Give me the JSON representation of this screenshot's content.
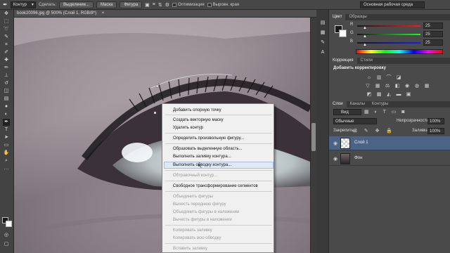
{
  "options_bar": {
    "mode": "Контур",
    "create_label": "Сделать:",
    "selection_btn": "Выделение...",
    "mask_btn": "Маска",
    "shape_btn": "Фигура",
    "optimization": "Оптимизация",
    "align_edges": "Выровн. края",
    "workspace": "Основная рабочая среда"
  },
  "document_tab": {
    "title": "book20096.jpg @ 500% (Слой 1, RGB/8*)",
    "close": "×"
  },
  "context_menu": {
    "items": [
      {
        "label": "Добавить опорную точку",
        "enabled": true
      },
      {
        "label": "Создать векторную маску",
        "enabled": true
      },
      {
        "label": "Удалить контур",
        "enabled": true
      },
      {
        "label": "Определить произвольную фигуру...",
        "enabled": true
      },
      {
        "label": "Образовать выделенную область...",
        "enabled": true
      },
      {
        "label": "Выполнить заливку контура...",
        "enabled": true
      },
      {
        "label": "Выполнить обводку контура...",
        "enabled": true
      },
      {
        "label": "Обтравочный контур...",
        "enabled": false
      },
      {
        "label": "Свободное трансформирование сегментов",
        "enabled": true
      },
      {
        "label": "Объединить фигуры",
        "enabled": false
      },
      {
        "label": "Вычесть переднюю фигуру",
        "enabled": false
      },
      {
        "label": "Объединить фигуры в наложении",
        "enabled": false
      },
      {
        "label": "Вычесть фигуры в наложении",
        "enabled": false
      },
      {
        "label": "Копировать заливку",
        "enabled": false
      },
      {
        "label": "Копировать всю обводку",
        "enabled": false
      },
      {
        "label": "Вставить заливку",
        "enabled": false
      }
    ]
  },
  "color_panel": {
    "tabs": [
      "Цвет",
      "Образцы"
    ],
    "channels": [
      {
        "label": "R",
        "value": "25",
        "color": "#d03030"
      },
      {
        "label": "G",
        "value": "25",
        "color": "#30a030"
      },
      {
        "label": "B",
        "value": "25",
        "color": "#3050d0"
      }
    ]
  },
  "adjustments_panel": {
    "tabs": [
      "Коррекция",
      "Стили"
    ],
    "title": "Добавить корректировку"
  },
  "layers_panel": {
    "tabs": [
      "Слои",
      "Каналы",
      "Контуры"
    ],
    "filter": "Вид",
    "blend_mode": "Обычные",
    "opacity_label": "Непрозрачность:",
    "opacity": "100%",
    "lock_label": "Закрепить:",
    "fill_label": "Заливка:",
    "fill": "100%",
    "layers": [
      {
        "name": "Слой 1",
        "selected": true
      },
      {
        "name": "Фон",
        "selected": false
      }
    ]
  },
  "colors": {
    "accent": "#4b6385",
    "menu_bg": "#f0f0f0",
    "panel_bg": "#4a4a4a"
  }
}
